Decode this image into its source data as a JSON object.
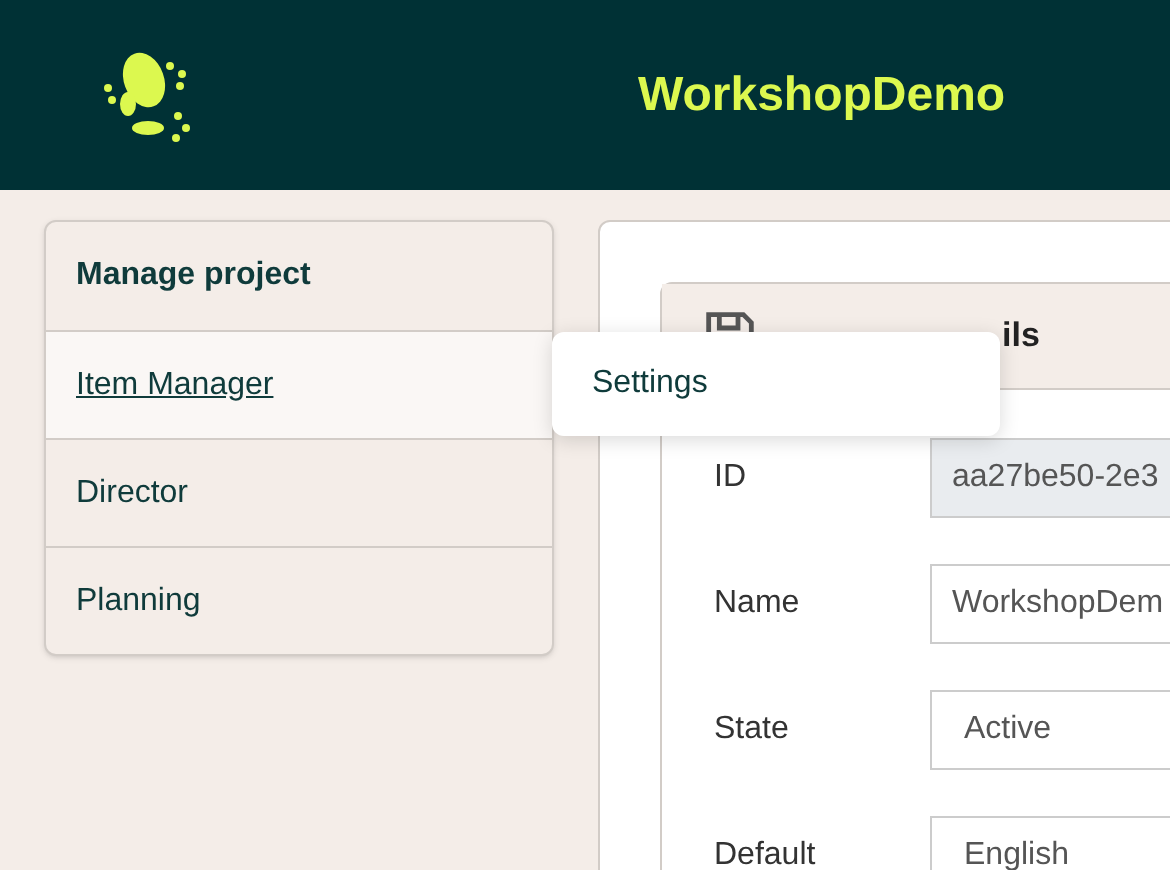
{
  "header": {
    "title": "WorkshopDemo"
  },
  "sidebar": {
    "items": [
      {
        "label": "Manage project",
        "selected": false,
        "bold": true
      },
      {
        "label": "Item Manager",
        "selected": true,
        "bold": false
      },
      {
        "label": "Director",
        "selected": false,
        "bold": false
      },
      {
        "label": "Planning",
        "selected": false,
        "bold": false
      }
    ]
  },
  "menu": {
    "items": [
      "Settings"
    ]
  },
  "panel": {
    "title": "ils",
    "fields": [
      {
        "label": "ID",
        "value": "aa27be50-2e3",
        "disabled": true
      },
      {
        "label": "Name",
        "value": "WorkshopDem",
        "disabled": false
      },
      {
        "label": "State",
        "value": "Active",
        "disabled": false
      },
      {
        "label": "Default",
        "value": "English",
        "disabled": false
      }
    ]
  }
}
